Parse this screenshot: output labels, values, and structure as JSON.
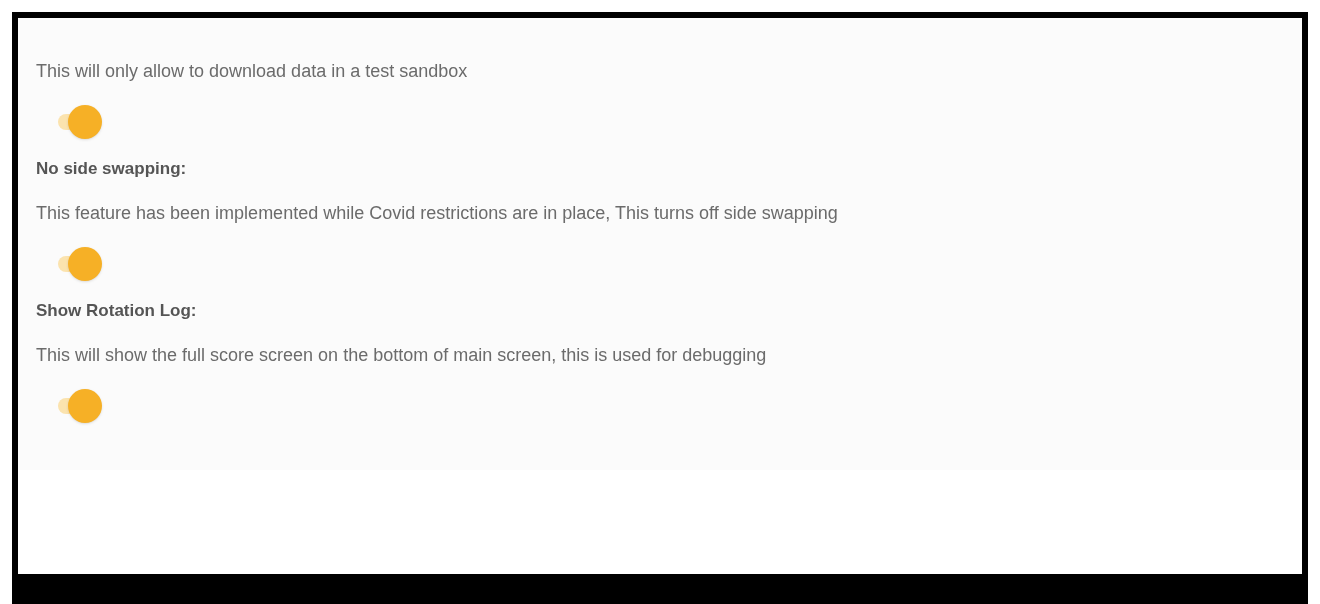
{
  "settings": [
    {
      "description": "This will only allow to download data in a test sandbox",
      "on": true
    },
    {
      "title": "No side swapping:",
      "description": "This feature has been implemented while Covid restrictions are in place, This turns off side swapping",
      "on": true
    },
    {
      "title": "Show Rotation Log:",
      "description": "This will show the full score screen on the bottom of main screen, this is used for debugging",
      "on": true
    }
  ]
}
